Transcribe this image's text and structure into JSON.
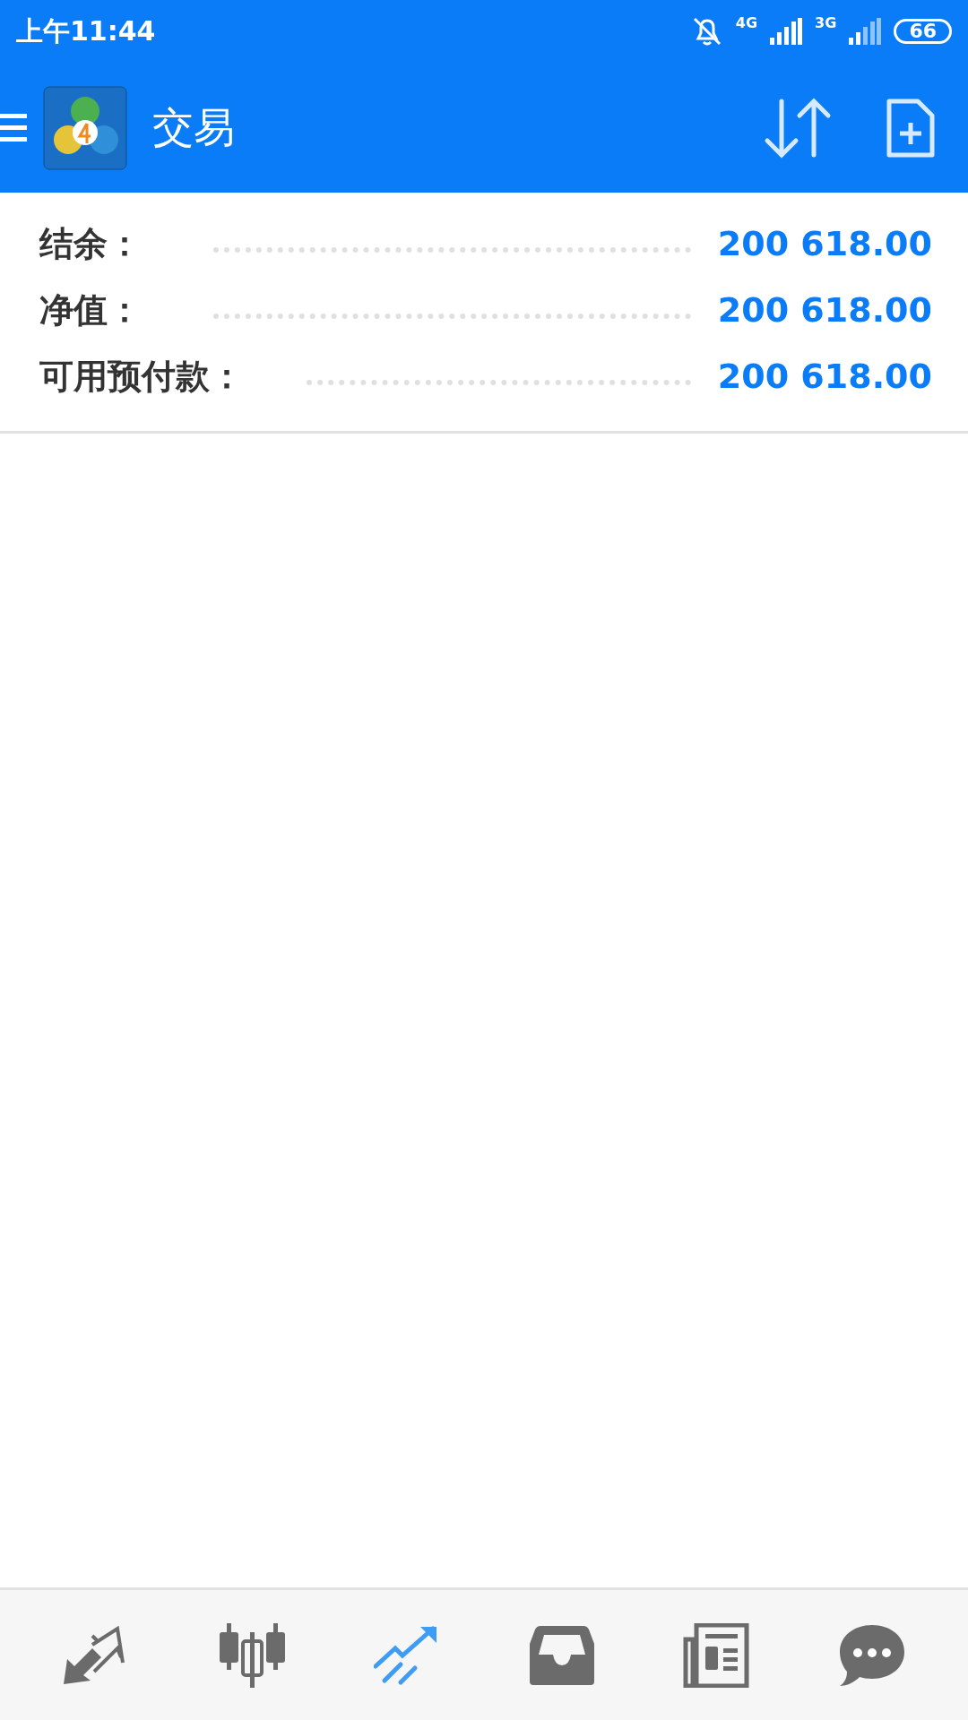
{
  "status_bar": {
    "time": "上午11:44",
    "network_1": "4G",
    "network_2": "3G",
    "battery": "66"
  },
  "header": {
    "title": "交易"
  },
  "summary": [
    {
      "label": "结余：",
      "value": "200 618.00"
    },
    {
      "label": "净值：",
      "value": "200 618.00"
    },
    {
      "label": "可用预付款：",
      "value": "200 618.00"
    }
  ],
  "bottom_nav": [
    {
      "kind": "quotes",
      "selected": false
    },
    {
      "kind": "charts",
      "selected": false
    },
    {
      "kind": "trade",
      "selected": true
    },
    {
      "kind": "history",
      "selected": false
    },
    {
      "kind": "news",
      "selected": false
    },
    {
      "kind": "chat",
      "selected": false
    }
  ]
}
